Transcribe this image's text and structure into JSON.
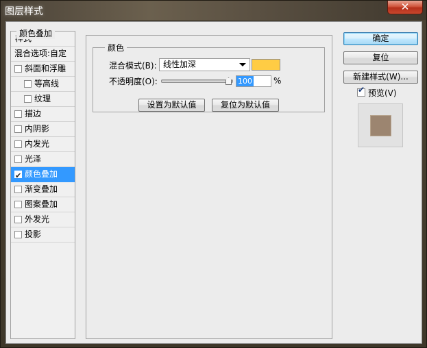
{
  "window": {
    "title": "图层样式",
    "close_label": "✕"
  },
  "styles": {
    "header": "样式",
    "blend_options": "混合选项:自定",
    "items": [
      {
        "label": "斜面和浮雕",
        "checked": false,
        "indent": false
      },
      {
        "label": "等高线",
        "checked": false,
        "indent": true
      },
      {
        "label": "纹理",
        "checked": false,
        "indent": true
      },
      {
        "label": "描边",
        "checked": false,
        "indent": false
      },
      {
        "label": "内阴影",
        "checked": false,
        "indent": false
      },
      {
        "label": "内发光",
        "checked": false,
        "indent": false
      },
      {
        "label": "光泽",
        "checked": false,
        "indent": false
      },
      {
        "label": "颜色叠加",
        "checked": true,
        "indent": false,
        "selected": true
      },
      {
        "label": "渐变叠加",
        "checked": false,
        "indent": false
      },
      {
        "label": "图案叠加",
        "checked": false,
        "indent": false
      },
      {
        "label": "外发光",
        "checked": false,
        "indent": false
      },
      {
        "label": "投影",
        "checked": false,
        "indent": false
      }
    ]
  },
  "panel": {
    "group_title": "颜色叠加",
    "sub_title": "颜色",
    "blend_label": "混合模式(B):",
    "blend_value": "线性加深",
    "overlay_color": "#ffcc44",
    "opacity_label": "不透明度(O):",
    "opacity_value": "100",
    "opacity_unit": "%",
    "opacity_level_percent": 100,
    "set_default_label": "设置为默认值",
    "reset_default_label": "复位为默认值"
  },
  "actions": {
    "ok_label": "确定",
    "reset_label": "复位",
    "new_style_label": "新建样式(W)...",
    "preview_label": "预览(V)",
    "preview_checked": true,
    "preview_color": "#9c8570"
  }
}
